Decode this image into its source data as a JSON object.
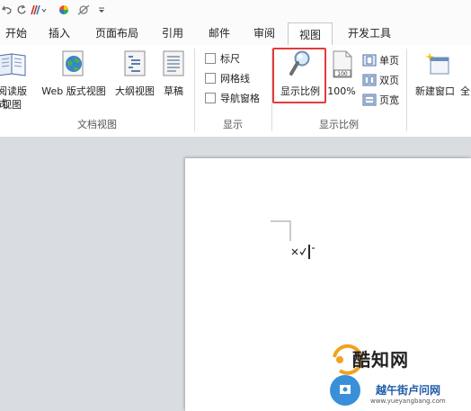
{
  "tabs": [
    {
      "label": "开始"
    },
    {
      "label": "插入"
    },
    {
      "label": "页面布局"
    },
    {
      "label": "引用"
    },
    {
      "label": "邮件"
    },
    {
      "label": "审阅"
    },
    {
      "label": "视图"
    },
    {
      "label": "开发工具"
    }
  ],
  "active_tab": "视图",
  "ribbon": {
    "doc_views": {
      "read_line1": "阅读版式",
      "read_line2": "视图",
      "web": "Web 版式视图",
      "outline": "大纲视图",
      "draft": "草稿",
      "group_label": "文档视图"
    },
    "show": {
      "ruler": "标尺",
      "gridlines": "网格线",
      "nav_pane": "导航窗格",
      "group_label": "显示"
    },
    "zoom": {
      "zoom_btn": "显示比例",
      "percent": "100%",
      "one_page": "单页",
      "two_pages": "双页",
      "page_width": "页宽",
      "group_label": "显示比例"
    },
    "window": {
      "new_window": "新建窗口",
      "arrange_all": "全"
    }
  },
  "watermark": {
    "brand": "酷知网",
    "sub": "越午街卢问网",
    "url": "www.yueyangbang.com"
  },
  "colors": {
    "highlight": "#e23b3b",
    "accent": "#2b6cb0"
  }
}
